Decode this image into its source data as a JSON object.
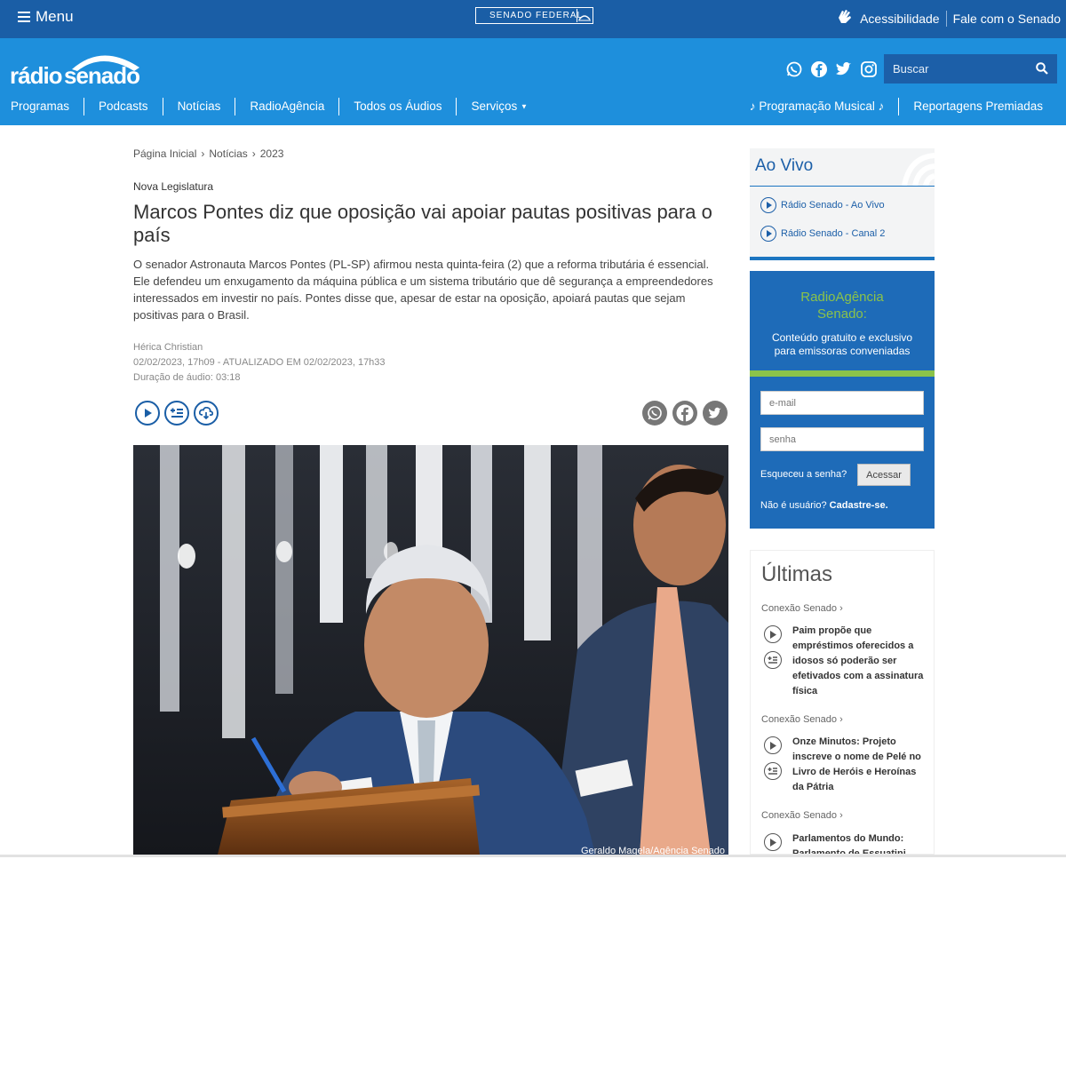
{
  "topbar": {
    "menu_label": "Menu",
    "senado_logo": "SENADO FEDERAL",
    "accessibility": "Acessibilidade",
    "contact": "Fale com o Senado"
  },
  "header": {
    "logo_part1": "rádio",
    "logo_part2": "senado",
    "search_placeholder": "Buscar",
    "nav": [
      "Programas",
      "Podcasts",
      "Notícias",
      "RadioAgência",
      "Todos os Áudios",
      "Serviços"
    ],
    "nav_right": [
      "♪ Programação Musical ♪",
      "Reportagens Premiadas"
    ]
  },
  "article": {
    "breadcrumb": [
      "Página Inicial",
      "Notícias",
      "2023"
    ],
    "kicker": "Nova Legislatura",
    "title": "Marcos Pontes diz que oposição vai apoiar pautas positivas para o país",
    "lead": "O senador Astronauta Marcos Pontes (PL-SP) afirmou nesta quinta-feira (2) que a reforma tributária é essencial. Ele defendeu um enxugamento da máquina pública e um sistema tributário que dê segurança a empreendedores interessados em investir no país. Pontes disse que, apesar de estar na oposição, apoiará pautas que sejam positivas para o Brasil.",
    "author": "Hérica Christian",
    "date": "02/02/2023, 17h09 - ATUALIZADO EM 02/02/2023, 17h33",
    "duration": "Duração de áudio: 03:18",
    "photo_credit": "Geraldo Magela/Agência Senado"
  },
  "aovivo": {
    "heading": "Ao Vivo",
    "links": [
      "Rádio Senado - Ao Vivo",
      "Rádio Senado - Canal 2"
    ]
  },
  "radioagencia": {
    "title_line1": "RadioAgência",
    "title_line2": "Senado:",
    "subtitle_line1": "Conteúdo gratuito e exclusivo",
    "subtitle_line2": "para emissoras conveniadas",
    "email_placeholder": "e-mail",
    "password_placeholder": "senha",
    "forgot": "Esqueceu a senha?",
    "login_button": "Acessar",
    "register_prefix": "Não é usuário?",
    "register_link": "Cadastre-se."
  },
  "ultimas": {
    "heading": "Últimas",
    "items": [
      {
        "category": "Conexão Senado ›",
        "title": "Paim propõe que empréstimos oferecidos a idosos só poderão ser efetivados com a assinatura física"
      },
      {
        "category": "Conexão Senado ›",
        "title": "Onze Minutos: Projeto inscreve o nome de Pelé no Livro de Heróis e Heroínas da Pátria"
      },
      {
        "category": "Conexão Senado ›",
        "title": "Parlamentos do Mundo: Parlamento de Essuatini"
      }
    ]
  },
  "colors": {
    "topbar": "#1a5ea6",
    "header": "#1e8fdc",
    "accent_green": "#8bc34a"
  }
}
